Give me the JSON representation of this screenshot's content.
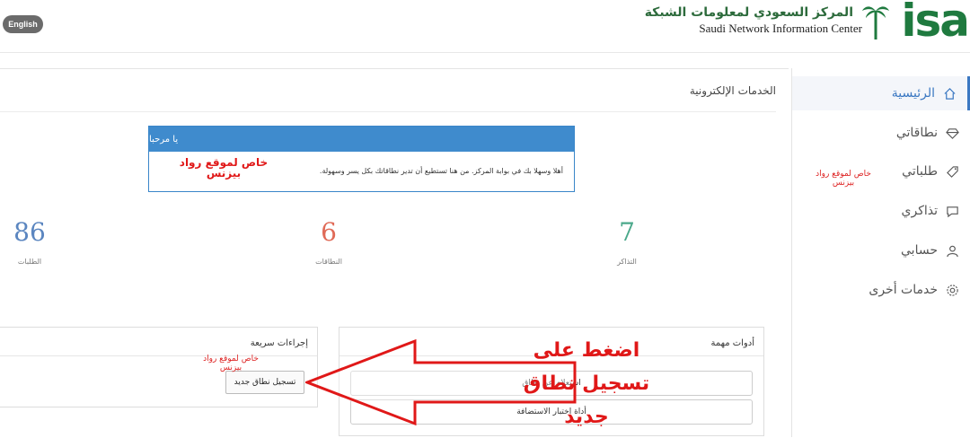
{
  "header": {
    "language_button": "English",
    "logo_arabic": "المركز السعودي لمعلومات الشبكة",
    "logo_english": "Saudi Network Information Center",
    "logo_mark": "isa"
  },
  "sidebar": {
    "items": [
      {
        "label": "الرئيسية",
        "icon": "home-icon"
      },
      {
        "label": "نطاقاتي",
        "icon": "diamond-icon"
      },
      {
        "label": "طلباتي",
        "icon": "tag-icon"
      },
      {
        "label": "تذاكري",
        "icon": "chat-icon"
      },
      {
        "label": "حسابي",
        "icon": "user-icon"
      },
      {
        "label": "خدمات أخرى",
        "icon": "gear-icon"
      }
    ],
    "note": "خاص لموقع رواد بيزنس"
  },
  "main": {
    "section_title": "الخدمات الإلكترونية",
    "welcome": {
      "title": "يا مرحبا",
      "body": "أهلا وسهلا بك في بوابة المركز. من هنا تستطيع أن تدير نطاقاتك بكل يسر وسهولة.",
      "note": "خاص لموقع رواد بيزنس"
    },
    "stats": [
      {
        "value": "7",
        "label": "التذاكر",
        "color": "#4aa88a"
      },
      {
        "value": "6",
        "label": "النطاقات",
        "color": "#e06a57"
      },
      {
        "value": "86",
        "label": "الطلبات",
        "color": "#5b86c0"
      }
    ],
    "tools": {
      "title": "أدوات مهمة",
      "buttons": [
        "استعلام عن نطاق",
        "أداة اختبار الاستضافة"
      ]
    },
    "quick": {
      "title": "إجراءات سريعة",
      "button": "تسجيل نطاق جديد",
      "note": "خاص لموقع رواد بيزنس"
    },
    "callout": {
      "line1": "اضغط على",
      "line2": "تسجيل نطاق",
      "line3": "جديد",
      "color": "#e01818"
    }
  }
}
